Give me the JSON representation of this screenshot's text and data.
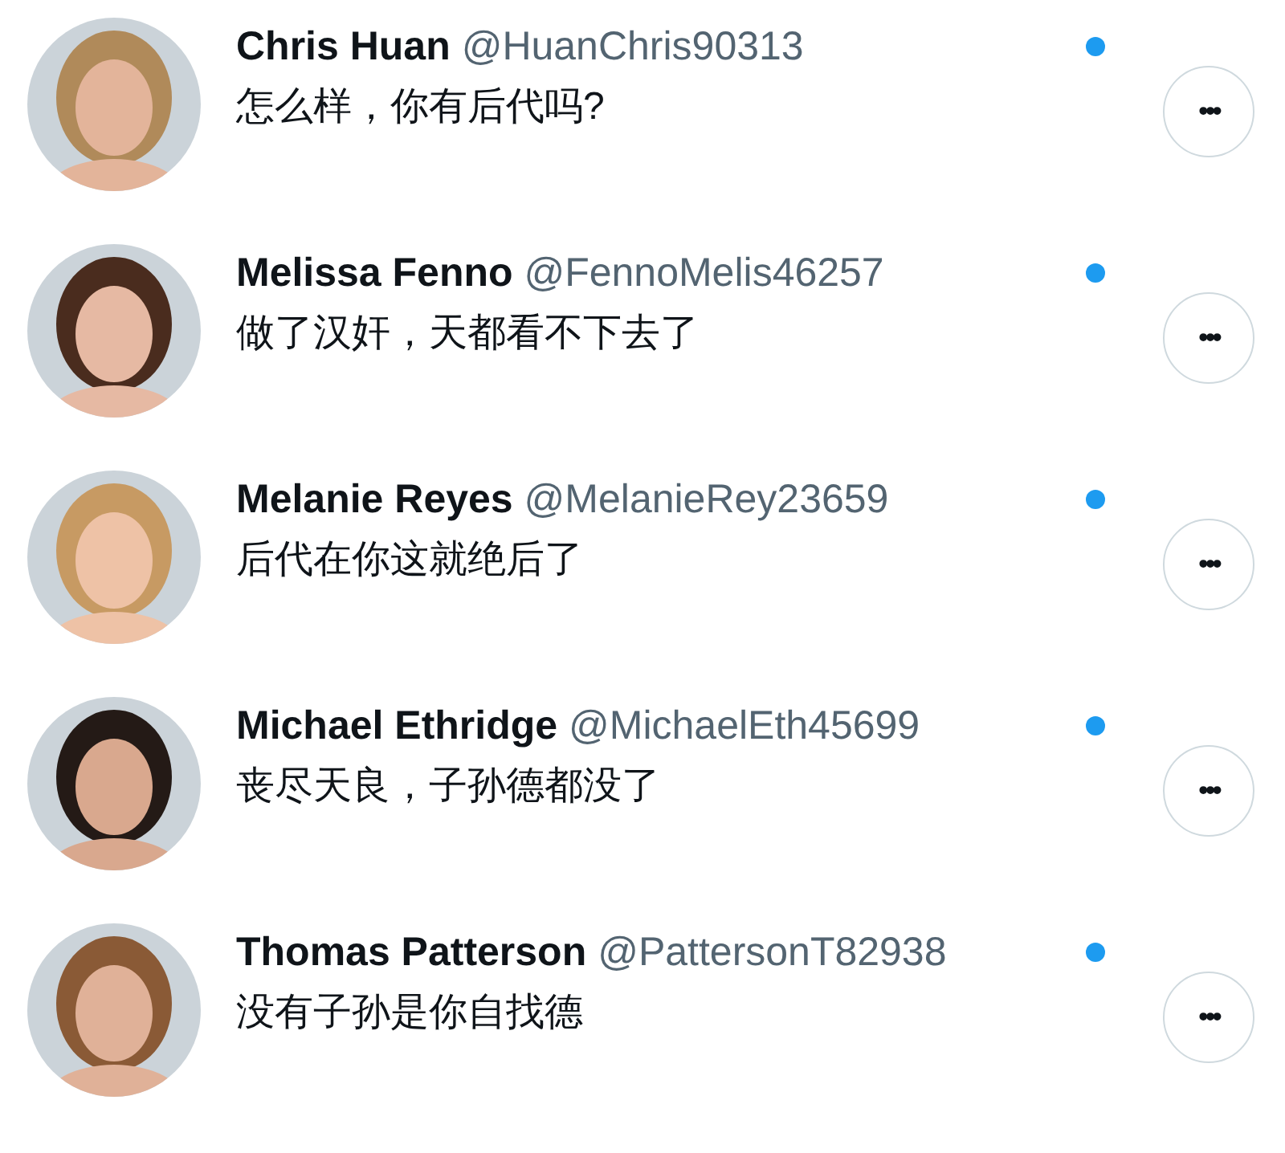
{
  "replies": [
    {
      "name": "Chris Huan",
      "handle": "@HuanChris90313",
      "text": "怎么样，你有后代吗?",
      "unread": true,
      "more": "•••"
    },
    {
      "name": "Melissa Fenno",
      "handle": "@FennoMelis46257",
      "text": "做了汉奸，天都看不下去了",
      "unread": true,
      "more": "•••"
    },
    {
      "name": "Melanie Reyes",
      "handle": "@MelanieRey23659",
      "text": "后代在你这就绝后了",
      "unread": true,
      "more": "•••"
    },
    {
      "name": "Michael Ethridge",
      "handle": "@MichaelEth45699",
      "text": "丧尽天良，子孙德都没了",
      "unread": true,
      "more": "•••"
    },
    {
      "name": "Thomas Patterson",
      "handle": "@PattersonT82938",
      "text": "没有子孙是你自找德",
      "unread": true,
      "more": "•••"
    }
  ]
}
